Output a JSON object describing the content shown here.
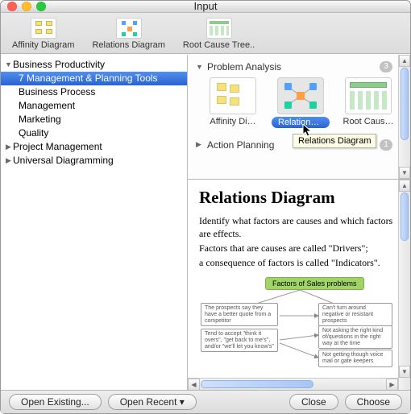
{
  "window": {
    "title": "Input"
  },
  "traffic_colors": {
    "close": "#ff5f57",
    "min": "#ffbd2e",
    "zoom": "#28c940"
  },
  "toolbar": {
    "items": [
      {
        "label": "Affinity Diagram"
      },
      {
        "label": "Relations Diagram"
      },
      {
        "label": "Root Cause Tree.."
      }
    ]
  },
  "sidebar": {
    "tree": [
      {
        "label": "Business Productivity",
        "expanded": true
      },
      {
        "label": "7 Management & Planning Tools",
        "child": true,
        "selected": true
      },
      {
        "label": "Business Process",
        "child": true
      },
      {
        "label": "Management",
        "child": true
      },
      {
        "label": "Marketing",
        "child": true
      },
      {
        "label": "Quality",
        "child": true
      },
      {
        "label": "Project Management",
        "expanded": false
      },
      {
        "label": "Universal Diagramming",
        "expanded": false
      }
    ]
  },
  "gallery": {
    "sections": [
      {
        "title": "Problem Analysis",
        "expanded": true,
        "count": "3"
      },
      {
        "title": "Action Planning",
        "expanded": false,
        "count": "1"
      }
    ],
    "thumbs": [
      {
        "label": "Affinity Di…"
      },
      {
        "label": "Relations…",
        "selected": true
      },
      {
        "label": "Root Caus…"
      }
    ],
    "tooltip": "Relations Diagram"
  },
  "preview": {
    "heading": "Relations Diagram",
    "line1": "Identify what factors are causes and which factors are effects.",
    "line2": "Factors that are causes are called \"Drivers\";",
    "line3": "a consequence of factors is called \"Indicators\".",
    "root_box": "Factors of Sales problems",
    "boxes": {
      "b1": "The prospects say they have a better quote from a competitor",
      "b2": "Tend to accept \"think it overs\", \"get back to me's\", and/or \"we'll let you know's\"",
      "b3": "Can't turn around negative or resistant prospects",
      "b4": "Not asking the right kind of/questions in the right way at the time",
      "b5": "Not getting though voice mail or gate keepers"
    }
  },
  "footer": {
    "open_existing": "Open Existing...",
    "open_recent": "Open Recent ▾",
    "close": "Close",
    "choose": "Choose"
  }
}
